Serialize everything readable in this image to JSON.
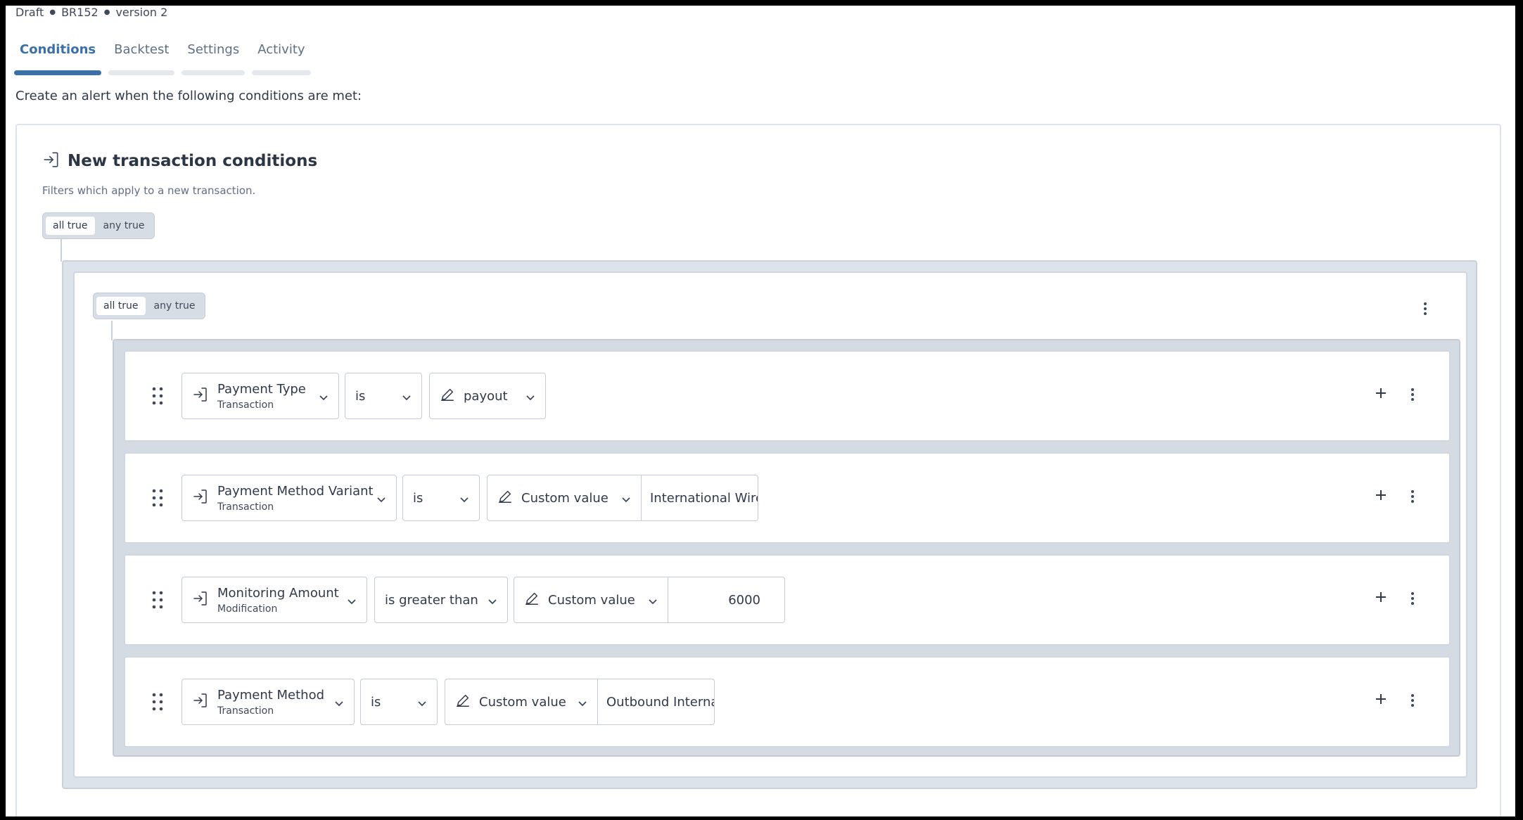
{
  "meta": {
    "status": "Draft",
    "id": "BR152",
    "version": "version 2"
  },
  "tabs": [
    {
      "label": "Conditions",
      "active": true
    },
    {
      "label": "Backtest",
      "active": false
    },
    {
      "label": "Settings",
      "active": false
    },
    {
      "label": "Activity",
      "active": false
    }
  ],
  "intro": "Create an alert when the following conditions are met:",
  "card": {
    "title": "New transaction conditions",
    "subtitle": "Filters which apply to a new transaction.",
    "toggle": {
      "all": "all true",
      "any": "any true"
    }
  },
  "group": {
    "toggle": {
      "all": "all true",
      "any": "any true"
    }
  },
  "rows": [
    {
      "field": "Payment Type",
      "source": "Transaction",
      "operator": "is",
      "value_mode": "payout",
      "value": ""
    },
    {
      "field": "Payment Method Variant",
      "source": "Transaction",
      "operator": "is",
      "value_mode": "Custom value",
      "value": "International Wire"
    },
    {
      "field": "Monitoring Amount",
      "source": "Modification",
      "operator": "is greater than",
      "value_mode": "Custom value",
      "value": "6000"
    },
    {
      "field": "Payment Method",
      "source": "Transaction",
      "operator": "is",
      "value_mode": "Custom value",
      "value": "Outbound Interna"
    }
  ],
  "colors": {
    "accent": "#3a6fa8",
    "group_bg": "#dde3ea"
  },
  "icons": [
    "login-arrow-icon",
    "pencil-icon",
    "chevron-down-icon",
    "drag-handle-icon",
    "plus-icon",
    "kebab-menu-icon"
  ]
}
